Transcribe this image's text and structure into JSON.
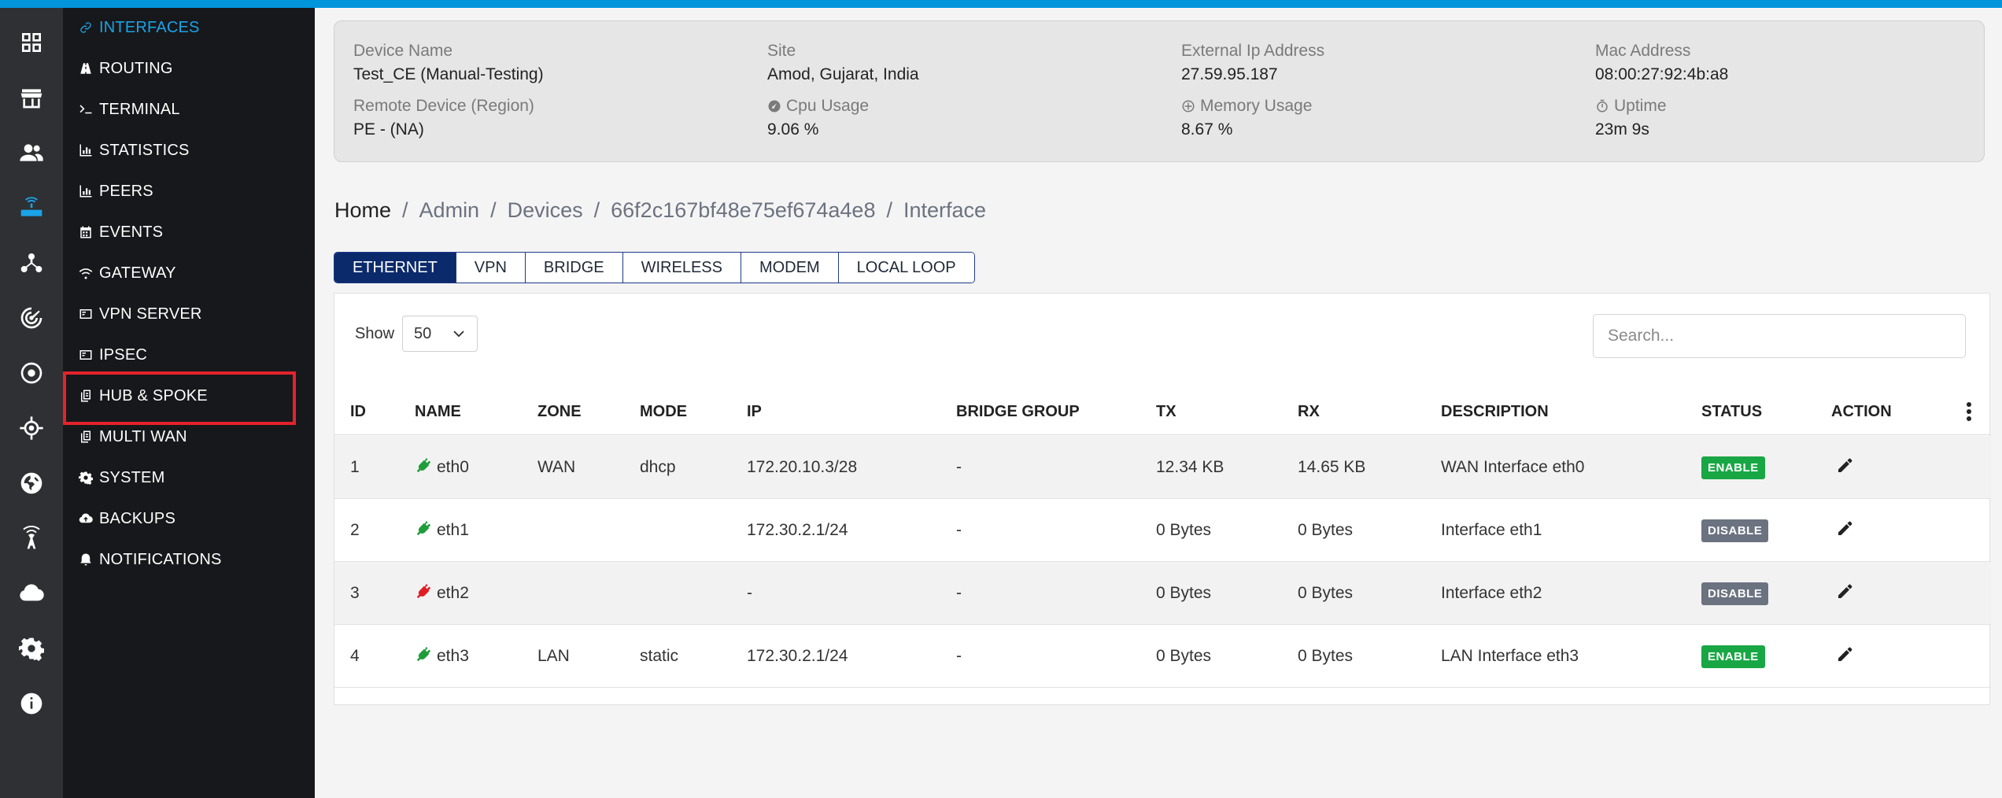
{
  "colors": {
    "accent": "#0095db",
    "active_menu": "#1aa3e8",
    "enable": "#18a744",
    "disable": "#6b7280",
    "plug_up": "#1f9d3a",
    "plug_down": "#e11d24",
    "tab_active": "#0b2a6b"
  },
  "icon_rail": [
    "dashboard-icon",
    "store-icon",
    "users-icon",
    "router-icon",
    "network-icon",
    "radar-icon",
    "target-icon",
    "crosshair-icon",
    "globe-icon",
    "broadcast-icon",
    "cloud-icon",
    "gear-icon",
    "info-icon"
  ],
  "sidebar": {
    "items": [
      {
        "label": "INTERFACES",
        "icon": "link-icon"
      },
      {
        "label": "ROUTING",
        "icon": "road-icon"
      },
      {
        "label": "TERMINAL",
        "icon": "terminal-icon"
      },
      {
        "label": "STATISTICS",
        "icon": "bar-chart-icon"
      },
      {
        "label": "PEERS",
        "icon": "bar-chart-icon"
      },
      {
        "label": "EVENTS",
        "icon": "calendar-icon"
      },
      {
        "label": "GATEWAY",
        "icon": "wifi-icon"
      },
      {
        "label": "VPN SERVER",
        "icon": "server-icon"
      },
      {
        "label": "IPSEC",
        "icon": "server-icon"
      },
      {
        "label": "HUB & SPOKE",
        "icon": "copy-icon"
      },
      {
        "label": "MULTI WAN",
        "icon": "copy-icon"
      },
      {
        "label": "SYSTEM",
        "icon": "gear-icon"
      },
      {
        "label": "BACKUPS",
        "icon": "cloud-upload-icon"
      },
      {
        "label": "NOTIFICATIONS",
        "icon": "bell-icon"
      }
    ]
  },
  "device": {
    "device_name_label": "Device Name",
    "device_name": "Test_CE (Manual-Testing)",
    "site_label": "Site",
    "site": "Amod, Gujarat, India",
    "external_ip_label": "External Ip Address",
    "external_ip": "27.59.95.187",
    "mac_label": "Mac Address",
    "mac": "08:00:27:92:4b:a8",
    "remote_label": "Remote Device (Region)",
    "remote": "PE - (NA)",
    "cpu_label": "Cpu Usage",
    "cpu": "9.06 %",
    "memory_label": "Memory Usage",
    "memory": "8.67 %",
    "uptime_label": "Uptime",
    "uptime": "23m 9s"
  },
  "breadcrumb": {
    "home": "Home",
    "sep": "/",
    "admin": "Admin",
    "devices": "Devices",
    "device_id": "66f2c167bf48e75ef674a4e8",
    "current": "Interface"
  },
  "tabs": [
    "ETHERNET",
    "VPN",
    "BRIDGE",
    "WIRELESS",
    "MODEM",
    "LOCAL LOOP"
  ],
  "table": {
    "show_label": "Show",
    "show_value": "50",
    "search_placeholder": "Search...",
    "columns": [
      "ID",
      "NAME",
      "ZONE",
      "MODE",
      "IP",
      "BRIDGE GROUP",
      "TX",
      "RX",
      "DESCRIPTION",
      "STATUS",
      "ACTION"
    ],
    "rows": [
      {
        "id": "1",
        "name": "eth0",
        "link": "up",
        "zone": "WAN",
        "mode": "dhcp",
        "ip": "172.20.10.3/28",
        "bridge": "-",
        "tx": "12.34 KB",
        "rx": "14.65 KB",
        "desc": "WAN Interface eth0",
        "status": "ENABLE"
      },
      {
        "id": "2",
        "name": "eth1",
        "link": "up",
        "zone": "",
        "mode": "",
        "ip": "172.30.2.1/24",
        "bridge": "-",
        "tx": "0 Bytes",
        "rx": "0 Bytes",
        "desc": "Interface eth1",
        "status": "DISABLE"
      },
      {
        "id": "3",
        "name": "eth2",
        "link": "down",
        "zone": "",
        "mode": "",
        "ip": "-",
        "bridge": "-",
        "tx": "0 Bytes",
        "rx": "0 Bytes",
        "desc": "Interface eth2",
        "status": "DISABLE"
      },
      {
        "id": "4",
        "name": "eth3",
        "link": "up",
        "zone": "LAN",
        "mode": "static",
        "ip": "172.30.2.1/24",
        "bridge": "-",
        "tx": "0 Bytes",
        "rx": "0 Bytes",
        "desc": "LAN Interface eth3",
        "status": "ENABLE"
      }
    ]
  }
}
